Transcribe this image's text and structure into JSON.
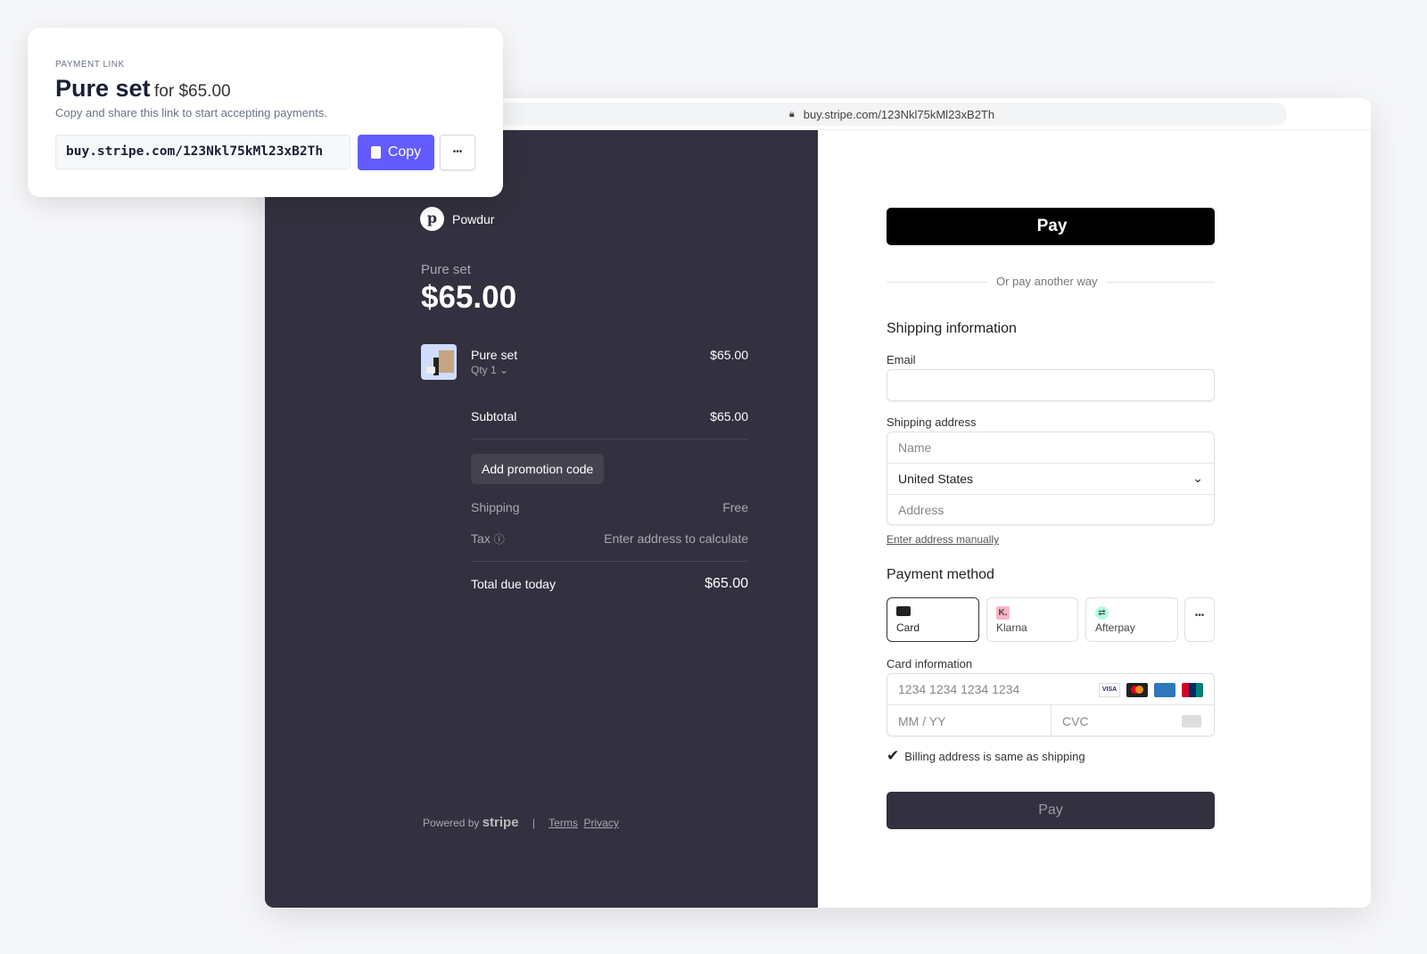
{
  "popup": {
    "eyebrow": "PAYMENT LINK",
    "title": "Pure set",
    "price_suffix": "for $65.00",
    "description": "Copy and share this link to start accepting payments.",
    "link": "buy.stripe.com/123Nkl75kMl23xB2Th",
    "copy_label": "Copy",
    "more_label": "•••",
    "accent": "#635bff"
  },
  "browser": {
    "url": "buy.stripe.com/123Nkl75kMl23xB2Th"
  },
  "summary": {
    "merchant_initial": "p",
    "merchant": "Powdur",
    "product_title": "Pure set",
    "price": "$65.00",
    "item": {
      "name": "Pure set",
      "qty": "Qty 1",
      "price": "$65.00"
    },
    "subtotal_label": "Subtotal",
    "subtotal": "$65.00",
    "promo_label": "Add promotion code",
    "shipping_label": "Shipping",
    "shipping": "Free",
    "tax_label": "Tax",
    "tax": "Enter address to calculate",
    "total_label": "Total due today",
    "total": "$65.00",
    "powered_by": "Powered by",
    "brand": "stripe",
    "terms": "Terms",
    "privacy": "Privacy",
    "bg": "#33303f"
  },
  "checkout": {
    "apple_pay": "Pay",
    "divider": "Or pay another way",
    "shipping_heading": "Shipping information",
    "email_label": "Email",
    "email_value": "",
    "address_label": "Shipping address",
    "name_placeholder": "Name",
    "country": "United States",
    "address_placeholder": "Address",
    "manual_link": "Enter address manually",
    "payment_heading": "Payment method",
    "methods": [
      {
        "label": "Card",
        "selected": true
      },
      {
        "label": "Klarna"
      },
      {
        "label": "Afterpay"
      }
    ],
    "more_methods": "•••",
    "card_label": "Card information",
    "card_placeholder": "1234 1234 1234 1234",
    "expiry_placeholder": "MM / YY",
    "cvc_placeholder": "CVC",
    "card_brands": [
      "VISA",
      "Mastercard",
      "Amex",
      "UnionPay"
    ],
    "billing_same": "Billing address is same as shipping",
    "billing_checked": true,
    "pay_label": "Pay"
  }
}
